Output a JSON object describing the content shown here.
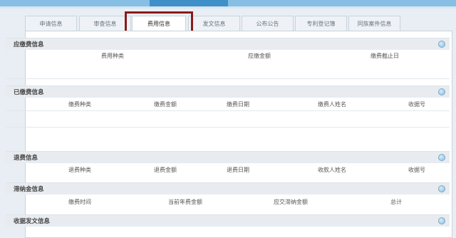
{
  "tabs": [
    {
      "label": "申请信息"
    },
    {
      "label": "审查信息"
    },
    {
      "label": "费用信息"
    },
    {
      "label": "发文信息"
    },
    {
      "label": "公布公告"
    },
    {
      "label": "专利登记簿"
    },
    {
      "label": "同族案件信息"
    }
  ],
  "active_tab": "费用信息",
  "sections": {
    "due_fees": {
      "title": "应缴费信息",
      "columns": [
        "费用种类",
        "应缴金额",
        "缴费截止日"
      ]
    },
    "paid_fees": {
      "title": "已缴费信息",
      "columns": [
        "缴费种类",
        "缴费金额",
        "缴费日期",
        "缴费人姓名",
        "收据号"
      ]
    },
    "refund": {
      "title": "退费信息",
      "columns": [
        "退费种类",
        "退费金额",
        "退费日期",
        "收款人姓名",
        "收据号"
      ]
    },
    "late_fee": {
      "title": "滞纳金信息",
      "columns": [
        "缴费时间",
        "当前年费金额",
        "应交滞纳金额",
        "总计"
      ]
    },
    "receipt": {
      "title": "收据发文信息"
    }
  },
  "colors": {
    "highlight": "#8b1a1a",
    "topbar": "#86bfe3",
    "accent": "#3f8fc8"
  },
  "icons": {
    "expand": "expand-icon"
  }
}
